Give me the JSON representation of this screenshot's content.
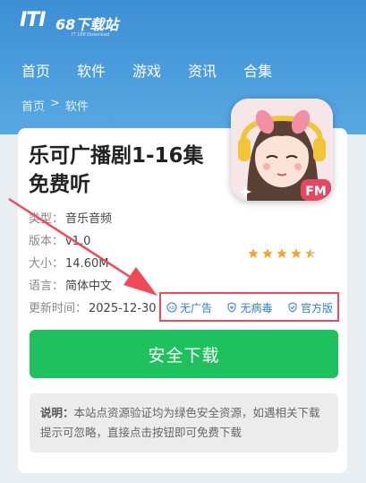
{
  "site": {
    "logo_mark": "ITI",
    "logo_name": "68下载站",
    "logo_sub": "IT 168 Download"
  },
  "nav": {
    "items": [
      {
        "label": "首页"
      },
      {
        "label": "软件"
      },
      {
        "label": "游戏"
      },
      {
        "label": "资讯"
      },
      {
        "label": "合集"
      }
    ]
  },
  "breadcrumb": {
    "home": "首页",
    "separator": ">",
    "current": "软件"
  },
  "app": {
    "title_line1": "乐可广播剧1-16集",
    "title_line2": "免费听",
    "icon_label": "FM",
    "rating_stars": 4.5,
    "info": [
      {
        "key": "类型：",
        "value": "音乐音频"
      },
      {
        "key": "版本：",
        "value": "v1.0"
      },
      {
        "key": "大小：",
        "value": "14.60M"
      },
      {
        "key": "语言：",
        "value": "简体中文"
      },
      {
        "key": "更新时间：",
        "value": "2025-12-30"
      }
    ]
  },
  "badges": {
    "no_ads": "无广告",
    "no_virus": "无病毒",
    "official": "官方版"
  },
  "download": {
    "label": "安全下载"
  },
  "note": {
    "prefix": "说明：",
    "text": "本站点资源验证均为绿色安全资源，如遇相关下载提示可忽略，直接点击按钮即可免费下载"
  },
  "colors": {
    "header": "#4b9edb",
    "download_button": "#1fc15e",
    "badge_text": "#2e7fd2",
    "highlight": "#f04a5a",
    "star": "#f0a531"
  }
}
